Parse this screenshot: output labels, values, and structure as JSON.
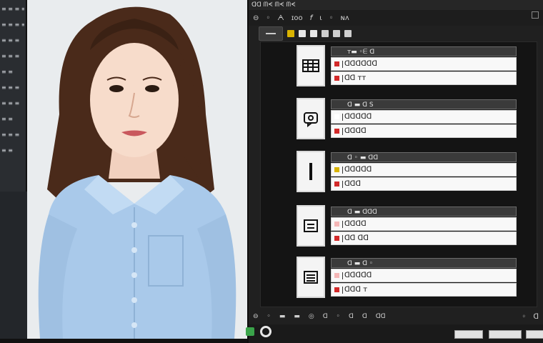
{
  "sidebar": {
    "items": [
      "≡ ≡ ≡ ≡",
      "≡ ≡ ≡ ≡",
      "≡ ≡ ≡",
      "≡ ≡ ≡",
      "≡ ≡",
      "≡ ≡ ≡",
      "≡ ≡ ≡",
      "≡ ≡",
      "≡ ≡ ≡",
      "≡ ≡"
    ]
  },
  "window": {
    "title": "ᗡᗡ ᗰᗕ ᗰᗕ ᗰᗕ"
  },
  "toolbar": {
    "buttons": [
      "⊖",
      "◦",
      "ᗅ",
      "ɪᴏᴏ",
      "𝘧",
      "ɩ",
      "◦",
      "ɴᴧ"
    ]
  },
  "toolbar2": {
    "icon_colors": [
      "#d9b300",
      "#e8e8e8",
      "#e8e8e8",
      "#cfcfcf",
      "#cfcfcf",
      "#cfcfcf"
    ]
  },
  "cards": [
    {
      "thumb_icon": "grid-icon",
      "header": "ᴛ▬ ◦ᗴ ᗡ",
      "rows": [
        {
          "mark_color": "#d32a2a",
          "text": "ᗡᗡᗡᗡᗡᗡ"
        },
        {
          "mark_color": "#d32a2a",
          "text": "ᗡᗡ  ᴛᴛ"
        }
      ]
    },
    {
      "thumb_icon": "chat-icon",
      "header": "ᗡ ▬ ᗡ  S",
      "rows": [
        {
          "mark_color": "#ffffff",
          "text": "ᗡᗡᗡᗡᗡ"
        },
        {
          "mark_color": "#d32a2a",
          "text": "ᗡᗡᗡᗡ"
        }
      ]
    },
    {
      "thumb_icon": "bar-icon",
      "header": "ᗡ ◦ ▬ ᗡᗡ",
      "rows": [
        {
          "mark_color": "#d9b300",
          "text": "ᗡᗡᗡᗡᗡ"
        },
        {
          "mark_color": "#d32a2a",
          "text": "ᗡᗡᗡ"
        }
      ]
    },
    {
      "thumb_icon": "doc-icon",
      "header": "ᗡ ▬ ᗡᗡᗡ",
      "rows": [
        {
          "mark_color": "#f4b6b6",
          "text": "ᗡᗡᗡᗡ"
        },
        {
          "mark_color": "#d32a2a",
          "text": "ᗡᗡ ᗡᗡ"
        }
      ]
    },
    {
      "thumb_icon": "list-icon",
      "header": "ᗡ ▬ ᗡ ◦",
      "rows": [
        {
          "mark_color": "#f4b6b6",
          "text": "ᗡᗡᗡᗡᗡ"
        },
        {
          "mark_color": "#d32a2a",
          "text": "ᗡᗡᗡ  ᴛ"
        }
      ]
    }
  ],
  "statusbar": {
    "left": [
      "⊖",
      "◦",
      "▬",
      "▬",
      "◎",
      "ᗡ",
      "◦",
      "ᗡ",
      "ᗡ",
      "ᗡᗡ"
    ],
    "right": [
      "◦",
      "ᗡ"
    ]
  }
}
